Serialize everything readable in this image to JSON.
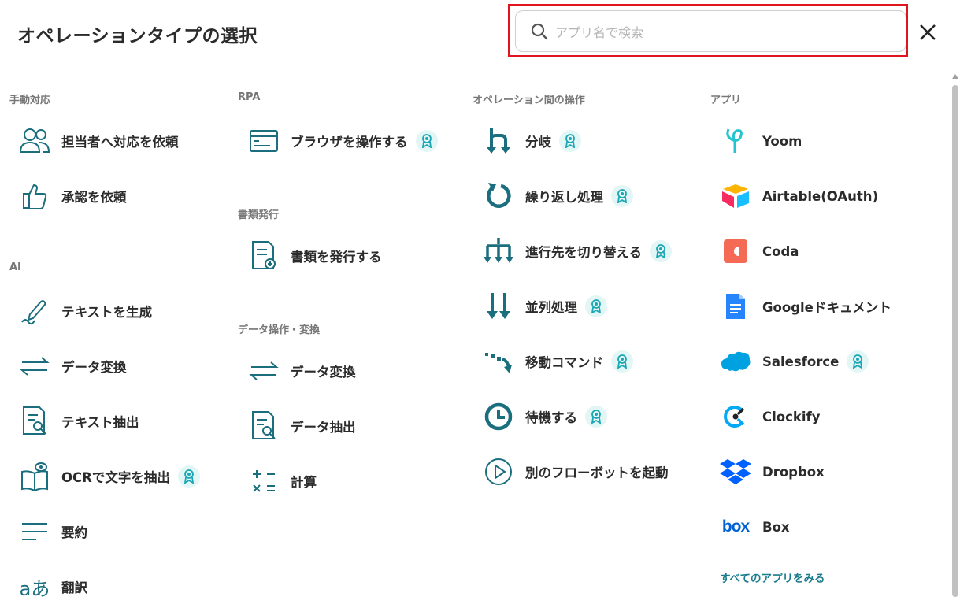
{
  "dialog": {
    "title": "オペレーションタイプの選択"
  },
  "search": {
    "placeholder": "アプリ名で検索"
  },
  "columns": {
    "manual": {
      "label": "手動対応",
      "items": [
        "担当者へ対応を依頼",
        "承認を依頼"
      ]
    },
    "ai": {
      "label": "AI",
      "items": [
        "テキストを生成",
        "データ変換",
        "テキスト抽出",
        "OCRで文字を抽出",
        "要約",
        "翻訳"
      ]
    },
    "rpa": {
      "label": "RPA",
      "items": [
        "ブラウザを操作する"
      ]
    },
    "docs": {
      "label": "書類発行",
      "items": [
        "書類を発行する"
      ]
    },
    "data_ops": {
      "label": "データ操作・変換",
      "items": [
        "データ変換",
        "データ抽出",
        "計算"
      ]
    },
    "between_ops": {
      "label": "オペレーション間の操作",
      "items": [
        "分岐",
        "繰り返し処理",
        "進行先を切り替える",
        "並列処理",
        "移動コマンド",
        "待機する",
        "別のフローボットを起動"
      ]
    },
    "apps": {
      "label": "アプリ",
      "items": [
        "Yoom",
        "Airtable(OAuth)",
        "Coda",
        "Googleドキュメント",
        "Salesforce",
        "Clockify",
        "Dropbox",
        "Box"
      ],
      "see_all": "すべてのアプリをみる"
    }
  },
  "colors": {
    "accent": "#1a6e7e",
    "teal": "#1aa6b5",
    "highlight": "#e0141c"
  }
}
